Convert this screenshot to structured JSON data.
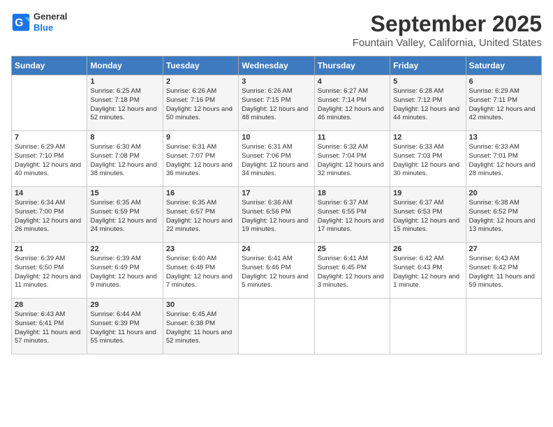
{
  "header": {
    "logo_general": "General",
    "logo_blue": "Blue",
    "month": "September 2025",
    "location": "Fountain Valley, California, United States"
  },
  "days_of_week": [
    "Sunday",
    "Monday",
    "Tuesday",
    "Wednesday",
    "Thursday",
    "Friday",
    "Saturday"
  ],
  "weeks": [
    [
      {
        "day": "",
        "sunrise": "",
        "sunset": "",
        "daylight": ""
      },
      {
        "day": "1",
        "sunrise": "Sunrise: 6:25 AM",
        "sunset": "Sunset: 7:18 PM",
        "daylight": "Daylight: 12 hours and 52 minutes."
      },
      {
        "day": "2",
        "sunrise": "Sunrise: 6:26 AM",
        "sunset": "Sunset: 7:16 PM",
        "daylight": "Daylight: 12 hours and 50 minutes."
      },
      {
        "day": "3",
        "sunrise": "Sunrise: 6:26 AM",
        "sunset": "Sunset: 7:15 PM",
        "daylight": "Daylight: 12 hours and 48 minutes."
      },
      {
        "day": "4",
        "sunrise": "Sunrise: 6:27 AM",
        "sunset": "Sunset: 7:14 PM",
        "daylight": "Daylight: 12 hours and 46 minutes."
      },
      {
        "day": "5",
        "sunrise": "Sunrise: 6:28 AM",
        "sunset": "Sunset: 7:12 PM",
        "daylight": "Daylight: 12 hours and 44 minutes."
      },
      {
        "day": "6",
        "sunrise": "Sunrise: 6:29 AM",
        "sunset": "Sunset: 7:11 PM",
        "daylight": "Daylight: 12 hours and 42 minutes."
      }
    ],
    [
      {
        "day": "7",
        "sunrise": "Sunrise: 6:29 AM",
        "sunset": "Sunset: 7:10 PM",
        "daylight": "Daylight: 12 hours and 40 minutes."
      },
      {
        "day": "8",
        "sunrise": "Sunrise: 6:30 AM",
        "sunset": "Sunset: 7:08 PM",
        "daylight": "Daylight: 12 hours and 38 minutes."
      },
      {
        "day": "9",
        "sunrise": "Sunrise: 6:31 AM",
        "sunset": "Sunset: 7:07 PM",
        "daylight": "Daylight: 12 hours and 36 minutes."
      },
      {
        "day": "10",
        "sunrise": "Sunrise: 6:31 AM",
        "sunset": "Sunset: 7:06 PM",
        "daylight": "Daylight: 12 hours and 34 minutes."
      },
      {
        "day": "11",
        "sunrise": "Sunrise: 6:32 AM",
        "sunset": "Sunset: 7:04 PM",
        "daylight": "Daylight: 12 hours and 32 minutes."
      },
      {
        "day": "12",
        "sunrise": "Sunrise: 6:33 AM",
        "sunset": "Sunset: 7:03 PM",
        "daylight": "Daylight: 12 hours and 30 minutes."
      },
      {
        "day": "13",
        "sunrise": "Sunrise: 6:33 AM",
        "sunset": "Sunset: 7:01 PM",
        "daylight": "Daylight: 12 hours and 28 minutes."
      }
    ],
    [
      {
        "day": "14",
        "sunrise": "Sunrise: 6:34 AM",
        "sunset": "Sunset: 7:00 PM",
        "daylight": "Daylight: 12 hours and 26 minutes."
      },
      {
        "day": "15",
        "sunrise": "Sunrise: 6:35 AM",
        "sunset": "Sunset: 6:59 PM",
        "daylight": "Daylight: 12 hours and 24 minutes."
      },
      {
        "day": "16",
        "sunrise": "Sunrise: 6:35 AM",
        "sunset": "Sunset: 6:57 PM",
        "daylight": "Daylight: 12 hours and 22 minutes."
      },
      {
        "day": "17",
        "sunrise": "Sunrise: 6:36 AM",
        "sunset": "Sunset: 6:56 PM",
        "daylight": "Daylight: 12 hours and 19 minutes."
      },
      {
        "day": "18",
        "sunrise": "Sunrise: 6:37 AM",
        "sunset": "Sunset: 6:55 PM",
        "daylight": "Daylight: 12 hours and 17 minutes."
      },
      {
        "day": "19",
        "sunrise": "Sunrise: 6:37 AM",
        "sunset": "Sunset: 6:53 PM",
        "daylight": "Daylight: 12 hours and 15 minutes."
      },
      {
        "day": "20",
        "sunrise": "Sunrise: 6:38 AM",
        "sunset": "Sunset: 6:52 PM",
        "daylight": "Daylight: 12 hours and 13 minutes."
      }
    ],
    [
      {
        "day": "21",
        "sunrise": "Sunrise: 6:39 AM",
        "sunset": "Sunset: 6:50 PM",
        "daylight": "Daylight: 12 hours and 11 minutes."
      },
      {
        "day": "22",
        "sunrise": "Sunrise: 6:39 AM",
        "sunset": "Sunset: 6:49 PM",
        "daylight": "Daylight: 12 hours and 9 minutes."
      },
      {
        "day": "23",
        "sunrise": "Sunrise: 6:40 AM",
        "sunset": "Sunset: 6:48 PM",
        "daylight": "Daylight: 12 hours and 7 minutes."
      },
      {
        "day": "24",
        "sunrise": "Sunrise: 6:41 AM",
        "sunset": "Sunset: 6:46 PM",
        "daylight": "Daylight: 12 hours and 5 minutes."
      },
      {
        "day": "25",
        "sunrise": "Sunrise: 6:41 AM",
        "sunset": "Sunset: 6:45 PM",
        "daylight": "Daylight: 12 hours and 3 minutes."
      },
      {
        "day": "26",
        "sunrise": "Sunrise: 6:42 AM",
        "sunset": "Sunset: 6:43 PM",
        "daylight": "Daylight: 12 hours and 1 minute."
      },
      {
        "day": "27",
        "sunrise": "Sunrise: 6:43 AM",
        "sunset": "Sunset: 6:42 PM",
        "daylight": "Daylight: 11 hours and 59 minutes."
      }
    ],
    [
      {
        "day": "28",
        "sunrise": "Sunrise: 6:43 AM",
        "sunset": "Sunset: 6:41 PM",
        "daylight": "Daylight: 11 hours and 57 minutes."
      },
      {
        "day": "29",
        "sunrise": "Sunrise: 6:44 AM",
        "sunset": "Sunset: 6:39 PM",
        "daylight": "Daylight: 11 hours and 55 minutes."
      },
      {
        "day": "30",
        "sunrise": "Sunrise: 6:45 AM",
        "sunset": "Sunset: 6:38 PM",
        "daylight": "Daylight: 11 hours and 52 minutes."
      },
      {
        "day": "",
        "sunrise": "",
        "sunset": "",
        "daylight": ""
      },
      {
        "day": "",
        "sunrise": "",
        "sunset": "",
        "daylight": ""
      },
      {
        "day": "",
        "sunrise": "",
        "sunset": "",
        "daylight": ""
      },
      {
        "day": "",
        "sunrise": "",
        "sunset": "",
        "daylight": ""
      }
    ]
  ]
}
